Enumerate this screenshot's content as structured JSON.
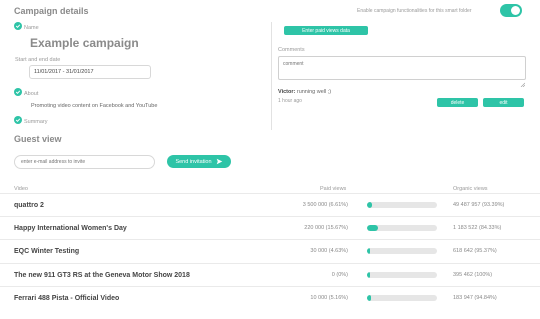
{
  "header": {
    "title": "Campaign details",
    "toggle_label": "Enable campaign functionalities for this smart folder",
    "toggle_on": true
  },
  "details": {
    "name_label": "Name",
    "name_value": "Example campaign",
    "date_label": "Start and end date",
    "date_value": "11/01/2017 - 31/01/2017",
    "about_label": "About",
    "about_value": "Promoting video content on Facebook and YouTube",
    "summary_label": "Summary"
  },
  "paid_views": {
    "enter_button": "Enter paid views data"
  },
  "comments": {
    "label": "Comments",
    "placeholder": "comment",
    "author": "Victor:",
    "text": "running well ;)",
    "time": "1 hour ago",
    "delete_label": "delete",
    "edit_label": "edit"
  },
  "guest": {
    "title": "Guest view",
    "email_placeholder": "enter e-mail address to invite",
    "send_label": "Send invitation"
  },
  "table": {
    "col_video": "Video",
    "col_paid": "Paid views",
    "col_organic": "Organic views",
    "rows": [
      {
        "name": "quattro 2",
        "paid": "3 500 000 (6.61%)",
        "paid_fraction": 0.0661,
        "organic": "49 487 957 (93.39%)"
      },
      {
        "name": "Happy International Women's Day",
        "paid": "220 000 (15.67%)",
        "paid_fraction": 0.1567,
        "organic": "1 183 522 (84.33%)"
      },
      {
        "name": "EQC Winter Testing",
        "paid": "30 000 (4.63%)",
        "paid_fraction": 0.0463,
        "organic": "618 642 (95.37%)"
      },
      {
        "name": "The new 911 GT3 RS at the Geneva Motor Show 2018",
        "paid": "0 (0%)",
        "paid_fraction": 0,
        "organic": "395 462 (100%)"
      },
      {
        "name": "Ferrari 488 Pista - Official Video",
        "paid": "10 000 (5.16%)",
        "paid_fraction": 0.0516,
        "organic": "183 947 (94.84%)"
      }
    ]
  },
  "colors": {
    "accent": "#2ec4a7"
  }
}
